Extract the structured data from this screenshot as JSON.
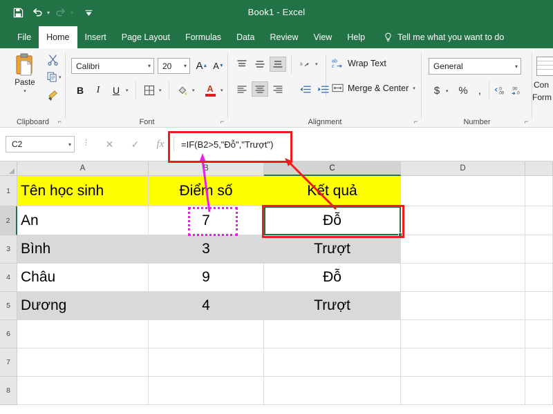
{
  "window": {
    "title": "Book1  -  Excel",
    "accent_green": "#217346"
  },
  "quick_access": {
    "save_icon": "save-icon",
    "undo_icon": "undo-icon",
    "redo_icon": "redo-icon",
    "customize_icon": "customize-quick-access-icon"
  },
  "ribbon": {
    "tabs": [
      {
        "label": "File",
        "active": false
      },
      {
        "label": "Home",
        "active": true
      },
      {
        "label": "Insert",
        "active": false
      },
      {
        "label": "Page Layout",
        "active": false
      },
      {
        "label": "Formulas",
        "active": false
      },
      {
        "label": "Data",
        "active": false
      },
      {
        "label": "Review",
        "active": false
      },
      {
        "label": "View",
        "active": false
      },
      {
        "label": "Help",
        "active": false
      }
    ],
    "tell_me": "Tell me what you want to do",
    "groups": {
      "clipboard": {
        "label": "Clipboard",
        "paste_label": "Paste",
        "cut_icon": "scissors-icon",
        "copy_icon": "copy-icon",
        "format_painter_icon": "format-painter-icon"
      },
      "font": {
        "label": "Font",
        "font_name": "Calibri",
        "font_size": "20",
        "grow_font_label": "A",
        "shrink_font_label": "A",
        "bold_label": "B",
        "italic_label": "I",
        "underline_label": "U",
        "borders_icon": "borders-icon",
        "fill_color_icon": "fill-color-icon",
        "font_color_label": "A"
      },
      "alignment": {
        "label": "Alignment",
        "wrap_text_label": "Wrap Text",
        "merge_center_label": "Merge & Center",
        "orientation_icon": "text-orientation-icon",
        "decrease_indent_icon": "decrease-indent-icon",
        "increase_indent_icon": "increase-indent-icon"
      },
      "number": {
        "label": "Number",
        "format": "General",
        "currency_label": "$",
        "percent_label": "%",
        "comma_label": ",",
        "increase_decimal_icon": "increase-decimal-icon",
        "decrease_decimal_icon": "decrease-decimal-icon"
      },
      "styles": {
        "conditional_formatting_line1": "Con",
        "conditional_formatting_line2": "Form"
      }
    }
  },
  "formula_bar": {
    "name_box": "C2",
    "cancel_icon": "cancel-icon",
    "enter_icon": "confirm-icon",
    "insert_function_icon": "insert-function-icon",
    "formula": "=IF(B2>5,\"Đỗ\",\"Trượt\")",
    "formula_parts": [
      {
        "text": "=IF(",
        "underline": null
      },
      {
        "text": "B2>5",
        "underline": "#e81ee8"
      },
      {
        "text": ",",
        "underline": null
      },
      {
        "text": "\"Đỗ\"",
        "underline": "#3bd92b"
      },
      {
        "text": ",",
        "underline": null
      },
      {
        "text": "\"Trượt\"",
        "underline": "#3b1b8c"
      },
      {
        "text": ")",
        "underline": null
      }
    ]
  },
  "sheet": {
    "columns": [
      "A",
      "B",
      "C",
      "D"
    ],
    "selected_column": "C",
    "rows": [
      "1",
      "2",
      "3",
      "4",
      "5",
      "6",
      "7",
      "8"
    ],
    "selected_row": "2",
    "header_row": [
      "Tên học sinh",
      "Điểm số",
      "Kết quả"
    ],
    "data_rows": [
      {
        "row": "2",
        "name": "An",
        "score": "7",
        "result": "Đỗ",
        "banded": false
      },
      {
        "row": "3",
        "name": "Bình",
        "score": "3",
        "result": "Trượt",
        "banded": true
      },
      {
        "row": "4",
        "name": "Châu",
        "score": "9",
        "result": "Đỗ",
        "banded": false
      },
      {
        "row": "5",
        "name": "Dương",
        "score": "4",
        "result": "Trượt",
        "banded": true
      }
    ],
    "active_cell": "C2",
    "traced_cell": "B2"
  },
  "annotations": {
    "formula_highlight_color": "#ee1c1c",
    "trace_border_color": "#e81ee8",
    "selection_color": "#217346"
  }
}
